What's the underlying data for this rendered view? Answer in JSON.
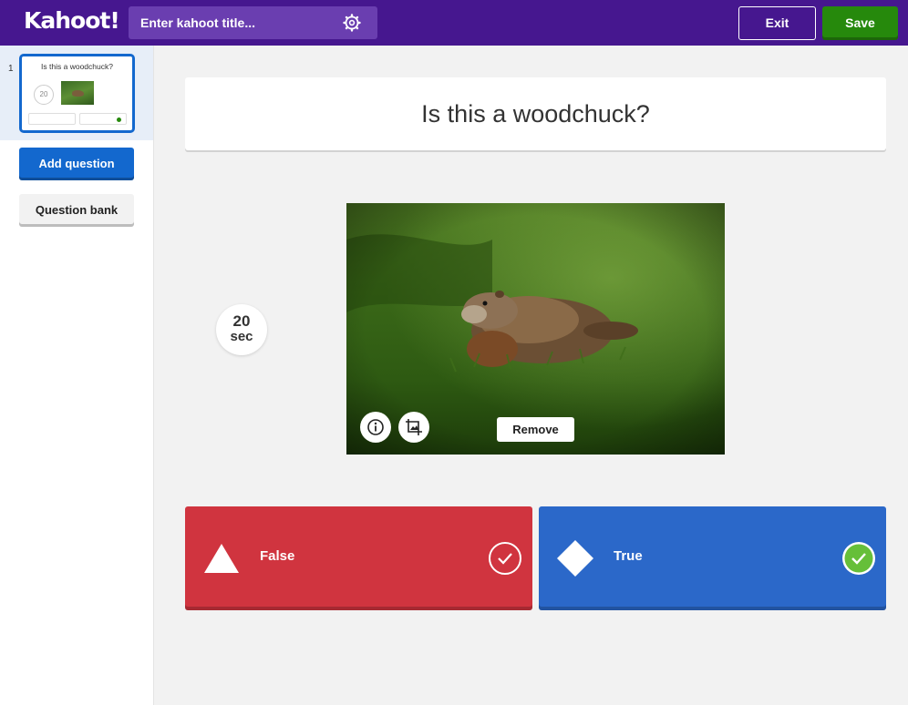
{
  "header": {
    "logo": "Kahoot!",
    "title_placeholder": "Enter kahoot title...",
    "exit_label": "Exit",
    "save_label": "Save"
  },
  "sidebar": {
    "slides": [
      {
        "number": "1",
        "title": "Is this a woodchuck?",
        "time": "20"
      }
    ],
    "add_question_label": "Add question",
    "question_bank_label": "Question bank"
  },
  "question": {
    "text": "Is this a woodchuck?",
    "time_value": "20",
    "time_unit": "sec",
    "remove_label": "Remove"
  },
  "answers": [
    {
      "label": "False",
      "color": "#d0343f",
      "shape": "triangle",
      "correct": false
    },
    {
      "label": "True",
      "color": "#2b68c9",
      "shape": "diamond",
      "correct": true
    }
  ],
  "colors": {
    "topbar": "#46178f",
    "title_input": "#6a3eb0",
    "save": "#26890c",
    "accent_blue": "#1368ce"
  }
}
